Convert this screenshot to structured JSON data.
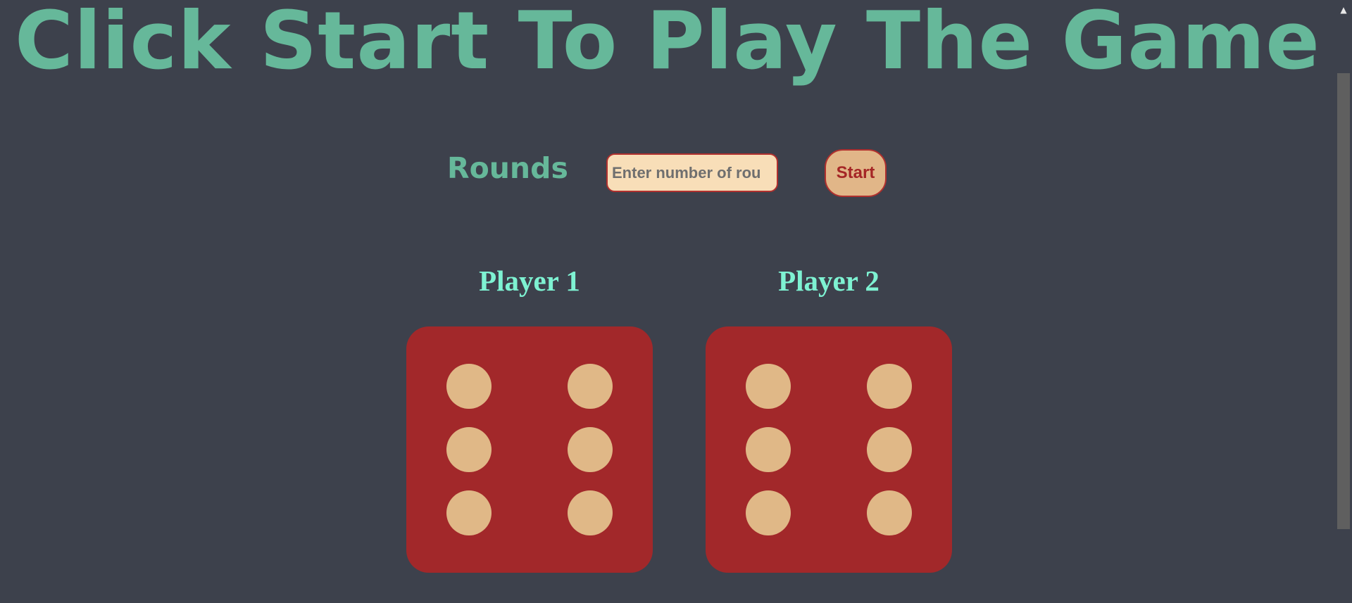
{
  "header": {
    "title": "Click Start To Play The Game"
  },
  "controls": {
    "rounds_label": "Rounds",
    "rounds_input_value": "",
    "rounds_input_placeholder": "Enter number of rounds",
    "start_label": "Start"
  },
  "players": [
    {
      "name": "Player 1",
      "die_value": 6
    },
    {
      "name": "Player 2",
      "die_value": 6
    }
  ],
  "colors": {
    "background": "#3d414c",
    "title": "#66b89a",
    "player_label": "#7ef2d2",
    "die_face": "#a2282a",
    "die_pip": "#e0b887",
    "input_bg": "#f8deb8",
    "button_bg": "#e1b688",
    "button_text": "#a52626"
  },
  "scrollbar": {
    "up_arrow_icon": "triangle-up-icon"
  }
}
